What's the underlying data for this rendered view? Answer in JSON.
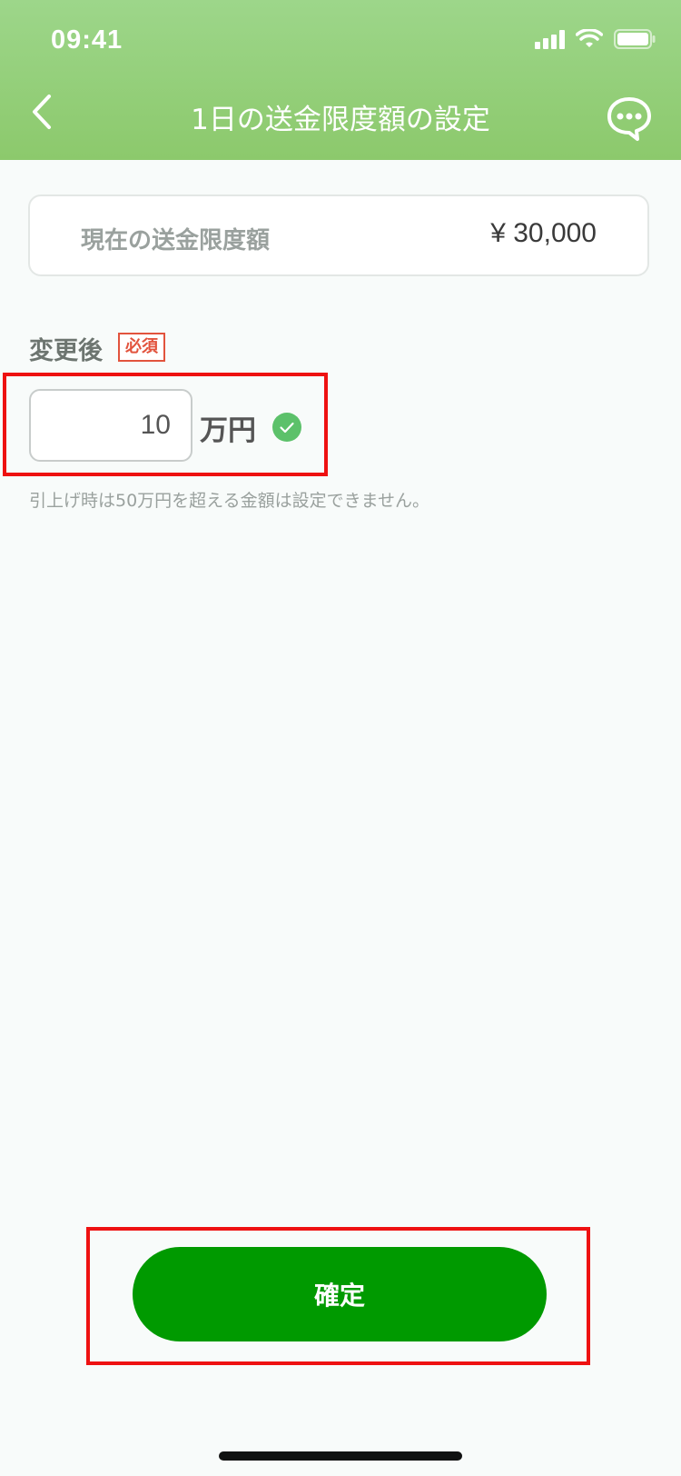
{
  "status_bar": {
    "time": "09:41"
  },
  "header": {
    "title": "1日の送金限度額の設定",
    "back_icon": "chevron-left-icon",
    "chat_icon": "chat-bubble-icon"
  },
  "current_limit": {
    "label": "現在の送金限度額",
    "value": "¥ 30,000"
  },
  "change": {
    "label": "変更後",
    "required_badge": "必須",
    "input_value": "10",
    "unit": "万円",
    "hint": "引上げ時は50万円を超える金額は設定できません。"
  },
  "confirm_button": {
    "label": "確定"
  },
  "colors": {
    "header_green": "#8cc96c",
    "button_green": "#009a00",
    "required_red": "#e2533d",
    "highlight_red": "#ee1111",
    "check_green": "#5cc16a"
  }
}
